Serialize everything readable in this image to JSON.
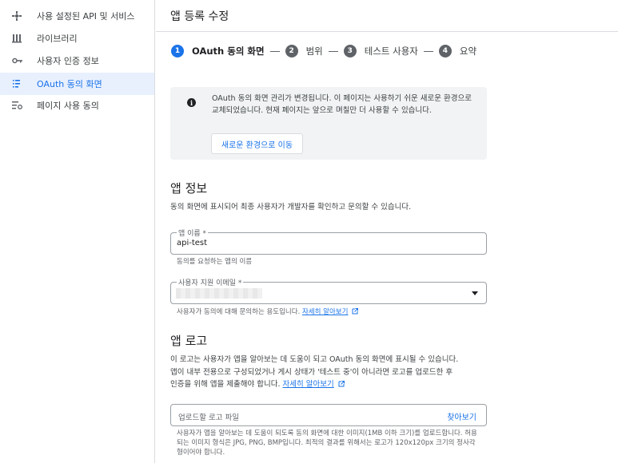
{
  "sidebar": {
    "items": [
      {
        "label": "사용 설정된 API 및 서비스",
        "icon": "api-services-icon"
      },
      {
        "label": "라이브러리",
        "icon": "library-icon"
      },
      {
        "label": "사용자 인증 정보",
        "icon": "key-icon"
      },
      {
        "label": "OAuth 동의 화면",
        "icon": "consent-screen-icon",
        "active": true
      },
      {
        "label": "페이지 사용 동의",
        "icon": "page-usage-icon"
      }
    ]
  },
  "header": {
    "title": "앱 등록 수정"
  },
  "stepper": {
    "steps": [
      {
        "num": "1",
        "label": "OAuth 동의 화면",
        "active": true
      },
      {
        "num": "2",
        "label": "범위"
      },
      {
        "num": "3",
        "label": "테스트 사용자"
      },
      {
        "num": "4",
        "label": "요약"
      }
    ]
  },
  "banner": {
    "text": "OAuth 동의 화면 관리가 변경됩니다. 이 페이지는 사용하기 쉬운 새로운 환경으로 교체되었습니다. 현재 페이지는 앞으로 며칠만 더 사용할 수 있습니다.",
    "button_label": "새로운 환경으로 이동"
  },
  "app_info": {
    "title": "앱 정보",
    "description": "동의 화면에 표시되어 최종 사용자가 개발자를 확인하고 문의할 수 있습니다.",
    "app_name": {
      "label": "앱 이름 *",
      "value": "api-test",
      "helper": "동의를 요청하는 앱의 이름"
    },
    "support_email": {
      "label": "사용자 지원 이메일 *",
      "helper": "사용자가 동의에 대해 문의하는 용도입니다.",
      "link": "자세히 알아보기"
    }
  },
  "app_logo": {
    "title": "앱 로고",
    "description_1": "이 로고는 사용자가 앱을 알아보는 데 도움이 되고 OAuth 동의 화면에 표시될 수 있습니다.",
    "description_2": "앱이 내부 전용으로 구성되었거나 게시 상태가 '테스트 중'이 아니라면 로고를 업로드한 후",
    "description_3": "인증을 위해 앱을 제출해야 합니다.",
    "link": "자세히 알아보기",
    "upload_placeholder": "업로드할 로고 파일",
    "upload_button": "찾아보기",
    "helper": "사용자가 앱을 알아보는 데 도움이 되도록 동의 화면에 대한 이미지(1MB 이하 크기)를 업로드합니다. 허용되는 이미지 형식은 JPG, PNG, BMP입니다. 최적의 결과를 위해서는 로고가 120x120px 크기의 정사각형이어야 합니다."
  }
}
